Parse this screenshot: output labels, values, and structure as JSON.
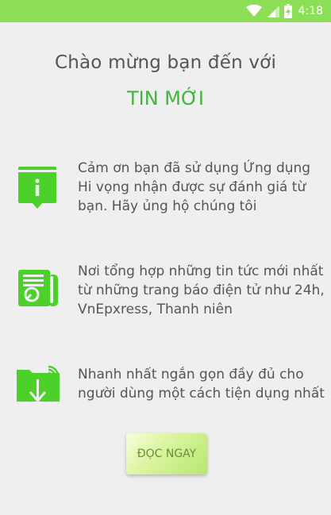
{
  "status_bar": {
    "time": "4:18",
    "icons": [
      "wifi-icon",
      "cellular-signal-icon",
      "battery-charging-icon"
    ]
  },
  "welcome": {
    "line1": "Chào mừng bạn đến với",
    "app_name": "TIN MỚI"
  },
  "features": [
    {
      "icon": "info-book-icon",
      "lines": [
        "Cảm ơn bạn đã sử dụng Ứng dụng",
        "Hi vọng nhận được sự đánh giá từ",
        "bạn. Hãy ủng hộ chúng tôi"
      ]
    },
    {
      "icon": "newspaper-icon",
      "lines": [
        "Nơi tổng hợp những tin tức mới nhất",
        "từ những trang báo điện tử như 24h,",
        "VnEpxress, Thanh niên"
      ]
    },
    {
      "icon": "folder-download-icon",
      "lines": [
        "Nhanh nhất ngắn gọn đầy đủ cho",
        "người dùng một cách tiện dụng nhất"
      ]
    }
  ],
  "read_button": {
    "label": "ĐỌC NGAY"
  },
  "colors": {
    "status_bar": "#8ddf58",
    "accent_green": "#3fb63a",
    "icon_green": "#4cd12b",
    "background": "#efefef"
  }
}
